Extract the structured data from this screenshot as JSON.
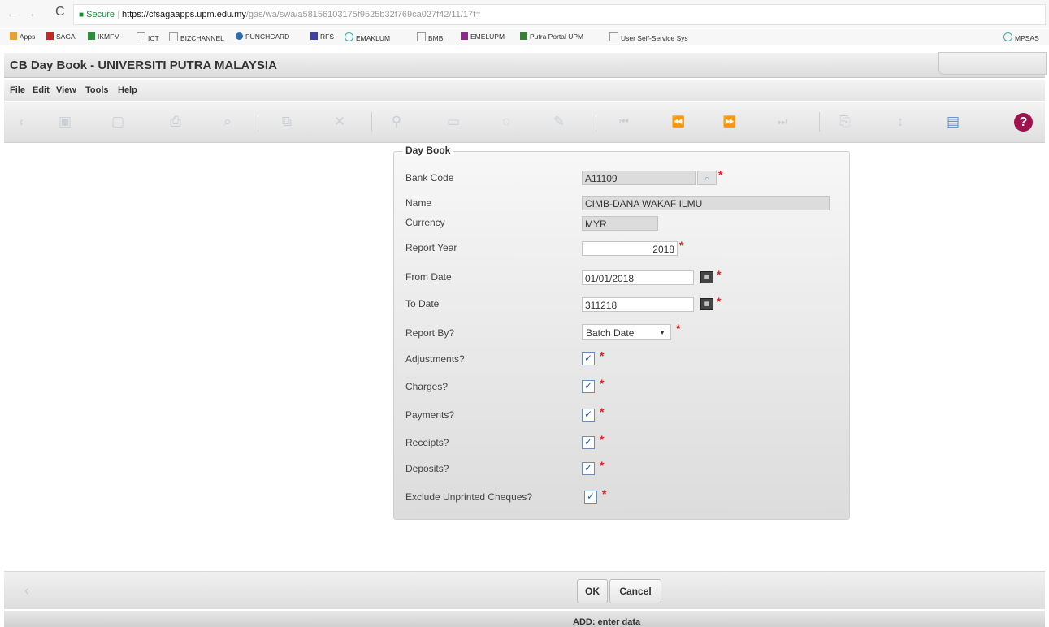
{
  "browser": {
    "secure_label": "Secure",
    "url_host": "https://cfsagaapps.upm.edu.my",
    "url_path": "/gas/wa/swa/a58156103175f9525b32f769ca027f42/11/17t=",
    "bookmarks": [
      "Apps",
      "SAGA",
      "IKMFM",
      "ICT",
      "BIZCHANNEL",
      "PUNCHCARD",
      "RFS",
      "EMAKLUM",
      "BMB",
      "EMELUPM",
      "Putra Portal UPM",
      "User Self-Service Sys",
      "MPSAS"
    ]
  },
  "app": {
    "title": "CB Day Book - UNIVERSITI PUTRA MALAYSIA",
    "menu": [
      "File",
      "Edit",
      "View",
      "Tools",
      "Help"
    ]
  },
  "form": {
    "title": "Day Book",
    "bank_code_label": "Bank Code",
    "bank_code": "A11109",
    "name_label": "Name",
    "name": "CIMB-DANA WAKAF ILMU",
    "currency_label": "Currency",
    "currency": "MYR",
    "report_year_label": "Report Year",
    "report_year": "2018",
    "from_date_label": "From Date",
    "from_date": "01/01/2018",
    "to_date_label": "To Date",
    "to_date": "311218",
    "report_by_label": "Report By?",
    "report_by": "Batch Date",
    "checkboxes": [
      {
        "label": "Adjustments?",
        "checked": true
      },
      {
        "label": "Charges?",
        "checked": true
      },
      {
        "label": "Payments?",
        "checked": true
      },
      {
        "label": "Receipts?",
        "checked": true
      },
      {
        "label": "Deposits?",
        "checked": true
      },
      {
        "label": "Exclude Unprinted Cheques?",
        "checked": true
      }
    ],
    "required_mark": "*",
    "check_mark": "✓"
  },
  "buttons": {
    "ok": "OK",
    "cancel": "Cancel"
  },
  "status": "ADD: enter data",
  "colors": {
    "required": "#e02020",
    "help": "#a0124e",
    "secure": "#1a8a3a"
  }
}
